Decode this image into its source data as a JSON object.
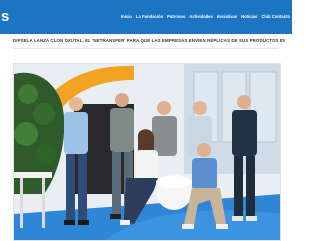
{
  "header": {
    "brand": "s",
    "nav": [
      {
        "label": "Inicio"
      },
      {
        "label": "La Fundación"
      },
      {
        "label": "Patronos"
      },
      {
        "label": "Actividades"
      },
      {
        "label": "Iniciativas"
      },
      {
        "label": "Noticias"
      },
      {
        "label": "Club Contacto"
      }
    ]
  },
  "article": {
    "headline": "DIPSELA LANZA CLON DIGITAL, EL 'NETRANSFER' PARA QUE LAS EMPRESAS ENVÍEN RÉPLICAS DE SUS PRODUCTOS EN 3D"
  },
  "colors": {
    "topbar": "#1d74c2",
    "floor": "#2f86d6",
    "wall_accent": "#f2a324"
  }
}
